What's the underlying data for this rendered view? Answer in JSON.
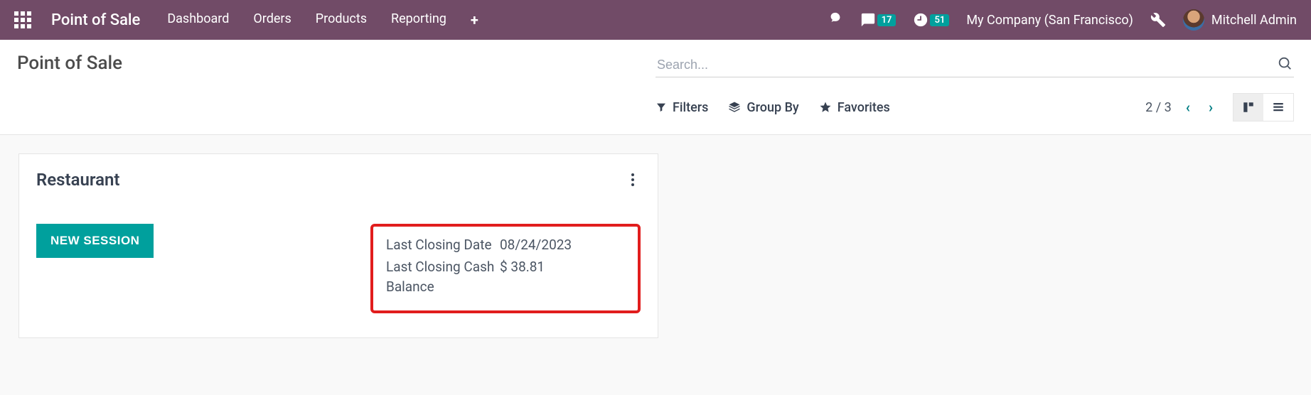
{
  "navbar": {
    "brand": "Point of Sale",
    "links": {
      "dashboard": "Dashboard",
      "orders": "Orders",
      "products": "Products",
      "reporting": "Reporting"
    },
    "msg_count": "17",
    "activity_count": "51",
    "company": "My Company (San Francisco)",
    "user": "Mitchell Admin"
  },
  "control": {
    "title": "Point of Sale",
    "search_placeholder": "Search...",
    "filters": "Filters",
    "groupby": "Group By",
    "favorites": "Favorites",
    "pager": "2 / 3"
  },
  "card": {
    "title": "Restaurant",
    "button": "NEW SESSION",
    "last_closing_date_label": "Last Closing Date",
    "last_closing_date_value": "08/24/2023",
    "last_closing_cash_label": "Last Closing Cash Balance",
    "last_closing_cash_value": "$ 38.81"
  }
}
